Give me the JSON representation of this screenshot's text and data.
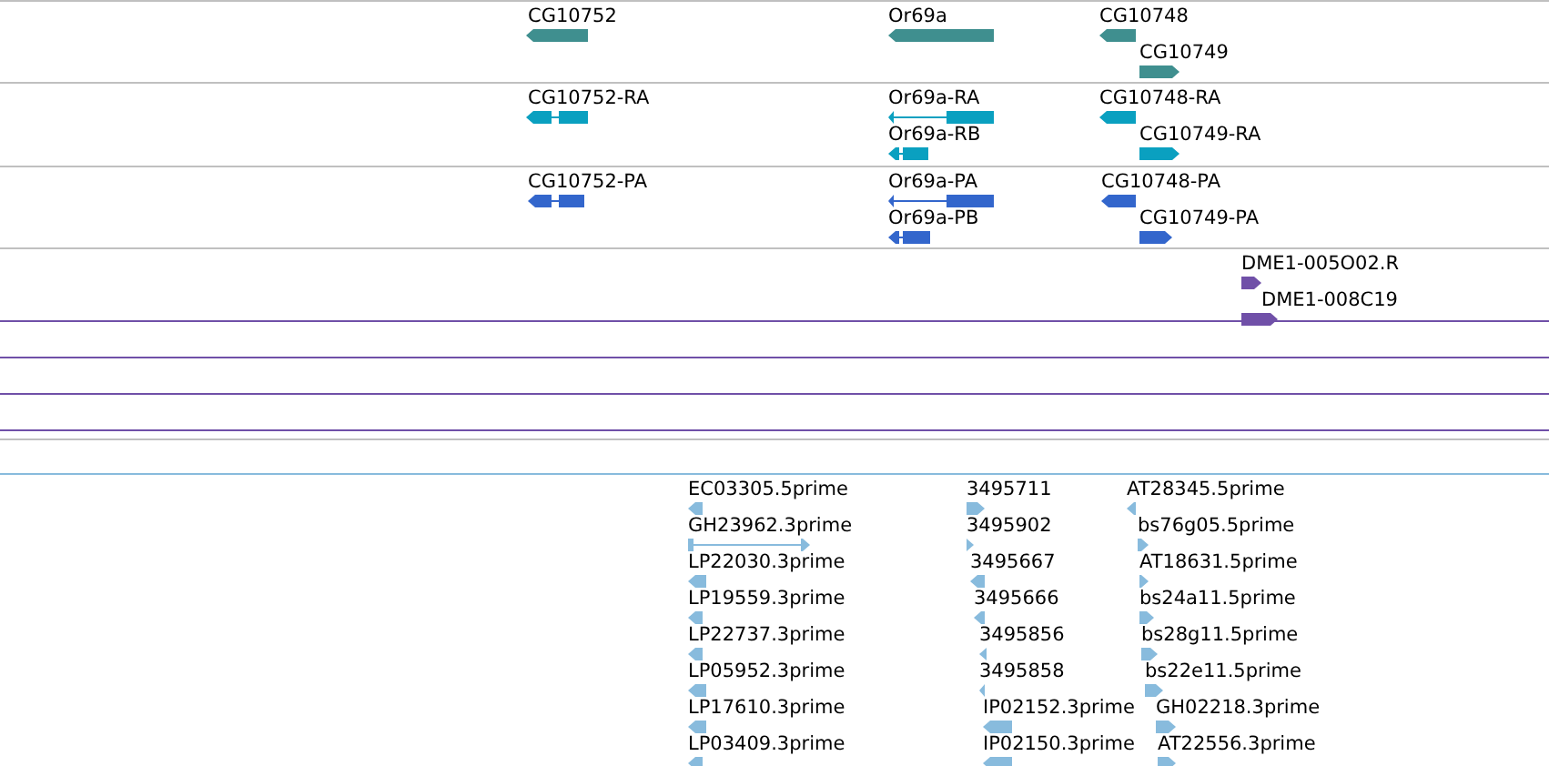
{
  "tracks": [
    {
      "kind": "gene",
      "color": "#3f8f8f",
      "features": [
        {
          "label": "CG10752",
          "reverse": true
        },
        {
          "label": "Or69a",
          "reverse": true
        },
        {
          "label": "CG10748",
          "reverse": true
        },
        {
          "label": "CG10749",
          "reverse": false
        }
      ]
    },
    {
      "kind": "mrna",
      "color": "#0aa0c0",
      "features": [
        {
          "label": "CG10752-RA",
          "reverse": true
        },
        {
          "label": "Or69a-RA",
          "reverse": true
        },
        {
          "label": "Or69a-RB",
          "reverse": true
        },
        {
          "label": "CG10748-RA",
          "reverse": true
        },
        {
          "label": "CG10749-RA",
          "reverse": false
        }
      ]
    },
    {
      "kind": "protein",
      "color": "#3366cc",
      "features": [
        {
          "label": "CG10752-PA",
          "reverse": true
        },
        {
          "label": "Or69a-PA",
          "reverse": true
        },
        {
          "label": "Or69a-PB",
          "reverse": true
        },
        {
          "label": "CG10748-PA",
          "reverse": true
        },
        {
          "label": "CG10749-PA",
          "reverse": false
        }
      ]
    },
    {
      "kind": "clone",
      "color": "#7050a8",
      "features": [
        {
          "label": "DME1-005O02.R",
          "reverse": false
        },
        {
          "label": "DME1-008C19",
          "reverse": false
        }
      ]
    },
    {
      "kind": "est",
      "color": "#88bbdd",
      "features": [
        {
          "label": "EC03305.5prime",
          "reverse": true
        },
        {
          "label": "GH23962.3prime",
          "reverse": false
        },
        {
          "label": "LP22030.3prime",
          "reverse": true
        },
        {
          "label": "LP19559.3prime",
          "reverse": true
        },
        {
          "label": "LP22737.3prime",
          "reverse": true
        },
        {
          "label": "LP05952.3prime",
          "reverse": true
        },
        {
          "label": "LP17610.3prime",
          "reverse": true
        },
        {
          "label": "LP03409.3prime",
          "reverse": true
        },
        {
          "label": "3495711",
          "reverse": false
        },
        {
          "label": "3495902",
          "reverse": false
        },
        {
          "label": "3495667",
          "reverse": true
        },
        {
          "label": "3495666",
          "reverse": true
        },
        {
          "label": "3495856",
          "reverse": true
        },
        {
          "label": "3495858",
          "reverse": true
        },
        {
          "label": "IP02152.3prime",
          "reverse": true
        },
        {
          "label": "IP02150.3prime",
          "reverse": true
        },
        {
          "label": "AT28345.5prime",
          "reverse": true
        },
        {
          "label": "bs76g05.5prime",
          "reverse": false
        },
        {
          "label": "AT18631.5prime",
          "reverse": false
        },
        {
          "label": "bs24a11.5prime",
          "reverse": false
        },
        {
          "label": "bs28g11.5prime",
          "reverse": false
        },
        {
          "label": "bs22e11.5prime",
          "reverse": false
        },
        {
          "label": "GH02218.3prime",
          "reverse": false
        },
        {
          "label": "AT22556.3prime",
          "reverse": false
        }
      ]
    }
  ]
}
